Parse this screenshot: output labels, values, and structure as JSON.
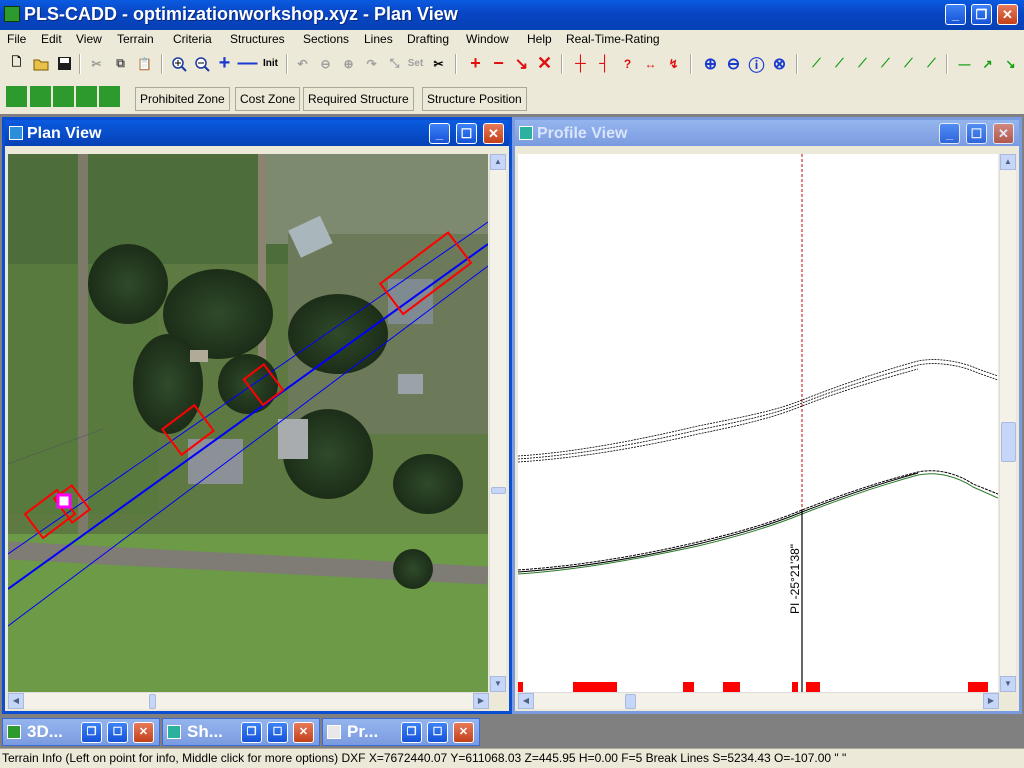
{
  "app": {
    "title": "PLS-CADD - optimizationworkshop.xyz - Plan View"
  },
  "menu": [
    "File",
    "Edit",
    "View",
    "Terrain",
    "Criteria",
    "Structures",
    "Sections",
    "Lines",
    "Drafting",
    "Window",
    "Help",
    "Real-Time-Rating"
  ],
  "toolbar2": {
    "prohibited_zone": "Prohibited Zone",
    "cost_zone": "Cost Zone",
    "required_structure": "Required Structure",
    "structure_position": "Structure Position"
  },
  "toolbar1": {
    "init_label": "Init",
    "set_label": "Set"
  },
  "plan_view": {
    "title": "Plan View"
  },
  "profile_view": {
    "title": "Profile View",
    "pi_label": "PI -25°21'38\""
  },
  "minimized": [
    {
      "label": "3D..."
    },
    {
      "label": "Sh..."
    },
    {
      "label": "Pr..."
    }
  ],
  "status": {
    "text": "Terrain Info (Left on point for info, Middle click for more options) DXF X=7672440.07 Y=611068.03 Z=445.95 H=0.00 F=5 Break Lines S=5234.43 O=-107.00 \" \""
  },
  "colors": {
    "xp_blue": "#0a4ed4",
    "alignment_blue": "#0000ff",
    "structure_red": "#ff0000",
    "selected_magenta": "#ff00ff",
    "ground_green": "#2a7a2a"
  }
}
